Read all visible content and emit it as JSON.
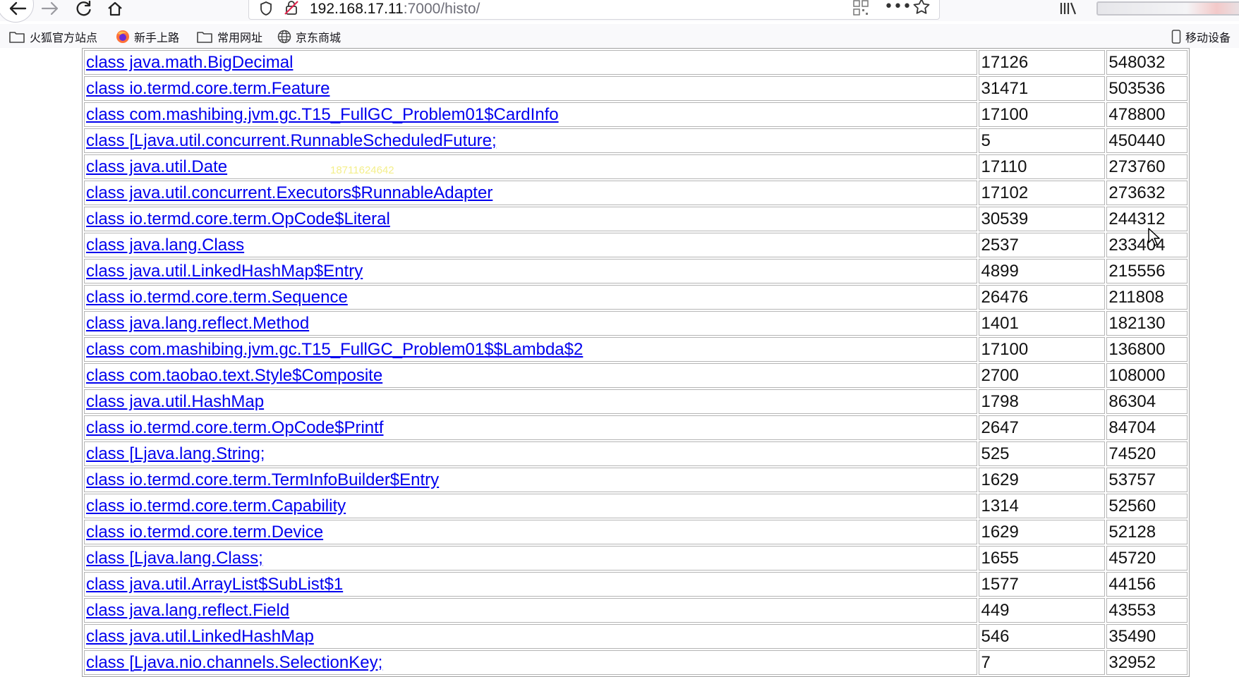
{
  "browser": {
    "url_host": "192.168.17.11",
    "url_path": ":7000/histo/",
    "bookmarks": [
      {
        "label": "火狐官方站点",
        "icon": "folder-icon"
      },
      {
        "label": "新手上路",
        "icon": "firefox-icon"
      },
      {
        "label": "常用网址",
        "icon": "folder-icon"
      },
      {
        "label": "京东商城",
        "icon": "globe-icon"
      }
    ],
    "mobile_bookmarks": "移动设备"
  },
  "watermark": "18711624642",
  "histogram": {
    "rows": [
      {
        "name": "class java.math.BigDecimal",
        "count": "17126",
        "bytes": "548032"
      },
      {
        "name": "class io.termd.core.term.Feature",
        "count": "31471",
        "bytes": "503536"
      },
      {
        "name": "class com.mashibing.jvm.gc.T15_FullGC_Problem01$CardInfo",
        "count": "17100",
        "bytes": "478800"
      },
      {
        "name": "class [Ljava.util.concurrent.RunnableScheduledFuture;",
        "count": "5",
        "bytes": "450440"
      },
      {
        "name": "class java.util.Date",
        "count": "17110",
        "bytes": "273760"
      },
      {
        "name": "class java.util.concurrent.Executors$RunnableAdapter",
        "count": "17102",
        "bytes": "273632"
      },
      {
        "name": "class io.termd.core.term.OpCode$Literal",
        "count": "30539",
        "bytes": "244312"
      },
      {
        "name": "class java.lang.Class",
        "count": "2537",
        "bytes": "233404"
      },
      {
        "name": "class java.util.LinkedHashMap$Entry",
        "count": "4899",
        "bytes": "215556"
      },
      {
        "name": "class io.termd.core.term.Sequence",
        "count": "26476",
        "bytes": "211808"
      },
      {
        "name": "class java.lang.reflect.Method",
        "count": "1401",
        "bytes": "182130"
      },
      {
        "name": "class com.mashibing.jvm.gc.T15_FullGC_Problem01$$Lambda$2",
        "count": "17100",
        "bytes": "136800"
      },
      {
        "name": "class com.taobao.text.Style$Composite",
        "count": "2700",
        "bytes": "108000"
      },
      {
        "name": "class java.util.HashMap",
        "count": "1798",
        "bytes": "86304"
      },
      {
        "name": "class io.termd.core.term.OpCode$Printf",
        "count": "2647",
        "bytes": "84704"
      },
      {
        "name": "class [Ljava.lang.String;",
        "count": "525",
        "bytes": "74520"
      },
      {
        "name": "class io.termd.core.term.TermInfoBuilder$Entry",
        "count": "1629",
        "bytes": "53757"
      },
      {
        "name": "class io.termd.core.term.Capability",
        "count": "1314",
        "bytes": "52560"
      },
      {
        "name": "class io.termd.core.term.Device",
        "count": "1629",
        "bytes": "52128"
      },
      {
        "name": "class [Ljava.lang.Class;",
        "count": "1655",
        "bytes": "45720"
      },
      {
        "name": "class java.util.ArrayList$SubList$1",
        "count": "1577",
        "bytes": "44156"
      },
      {
        "name": "class java.lang.reflect.Field",
        "count": "449",
        "bytes": "43553"
      },
      {
        "name": "class java.util.LinkedHashMap",
        "count": "546",
        "bytes": "35490"
      },
      {
        "name": "class [Ljava.nio.channels.SelectionKey;",
        "count": "7",
        "bytes": "32952"
      }
    ]
  }
}
